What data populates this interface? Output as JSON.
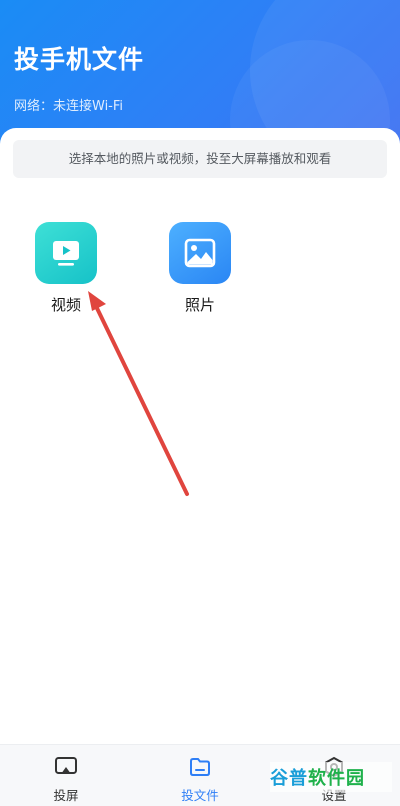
{
  "header": {
    "title": "投手机文件",
    "network_status": "网络：未连接Wi-Fi"
  },
  "hint": "选择本地的照片或视频，投至大屏幕播放和观看",
  "tiles": [
    {
      "label": "视频",
      "icon": "video-icon"
    },
    {
      "label": "照片",
      "icon": "photo-icon"
    }
  ],
  "tabbar": {
    "items": [
      {
        "label": "投屏",
        "icon": "cast-screen-icon",
        "active": false
      },
      {
        "label": "投文件",
        "icon": "folder-icon",
        "active": true
      },
      {
        "label": "设置",
        "icon": "settings-icon",
        "active": false
      }
    ]
  },
  "watermark": {
    "part1": "谷普",
    "part2": "软件园"
  },
  "colors": {
    "header": "#2f7ff6",
    "active_tab": "#2f7ff6",
    "video_tile": "#22cfcf",
    "photo_tile": "#3a9bfa",
    "annotation_arrow": "#e0453e"
  }
}
